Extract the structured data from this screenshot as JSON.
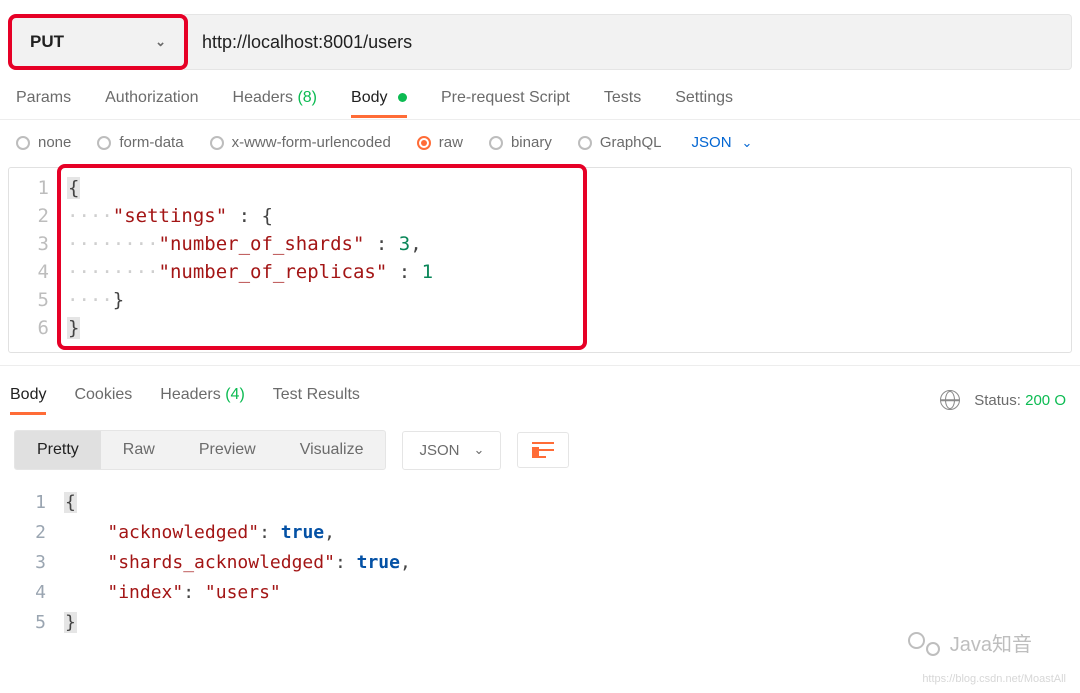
{
  "request": {
    "method": "PUT",
    "url": "http://localhost:8001/users"
  },
  "tabs": {
    "params": "Params",
    "authorization": "Authorization",
    "headers": "Headers",
    "headers_count": "(8)",
    "body": "Body",
    "prerequest": "Pre-request Script",
    "tests": "Tests",
    "settings": "Settings"
  },
  "body_types": {
    "none": "none",
    "formdata": "form-data",
    "urlencoded": "x-www-form-urlencoded",
    "raw": "raw",
    "binary": "binary",
    "graphql": "GraphQL",
    "lang": "JSON"
  },
  "request_body": {
    "lines": [
      "1",
      "2",
      "3",
      "4",
      "5",
      "6"
    ],
    "k_settings": "\"settings\"",
    "k_shards": "\"number_of_shards\"",
    "k_replicas": "\"number_of_replicas\"",
    "v_shards": "3",
    "v_replicas": "1"
  },
  "response": {
    "tabs": {
      "body": "Body",
      "cookies": "Cookies",
      "headers": "Headers",
      "headers_count": "(4)",
      "testresults": "Test Results"
    },
    "status_label": "Status:",
    "status_value": "200 O",
    "view_tabs": {
      "pretty": "Pretty",
      "raw": "Raw",
      "preview": "Preview",
      "visualize": "Visualize"
    },
    "lang": "JSON",
    "body": {
      "lines": [
        "1",
        "2",
        "3",
        "4",
        "5"
      ],
      "k_ack": "\"acknowledged\"",
      "k_shards_ack": "\"shards_acknowledged\"",
      "k_index": "\"index\"",
      "v_true": "true",
      "v_index": "\"users\""
    }
  },
  "watermark": {
    "text": "Java知音",
    "tiny": "https://blog.csdn.net/MoastAll"
  }
}
